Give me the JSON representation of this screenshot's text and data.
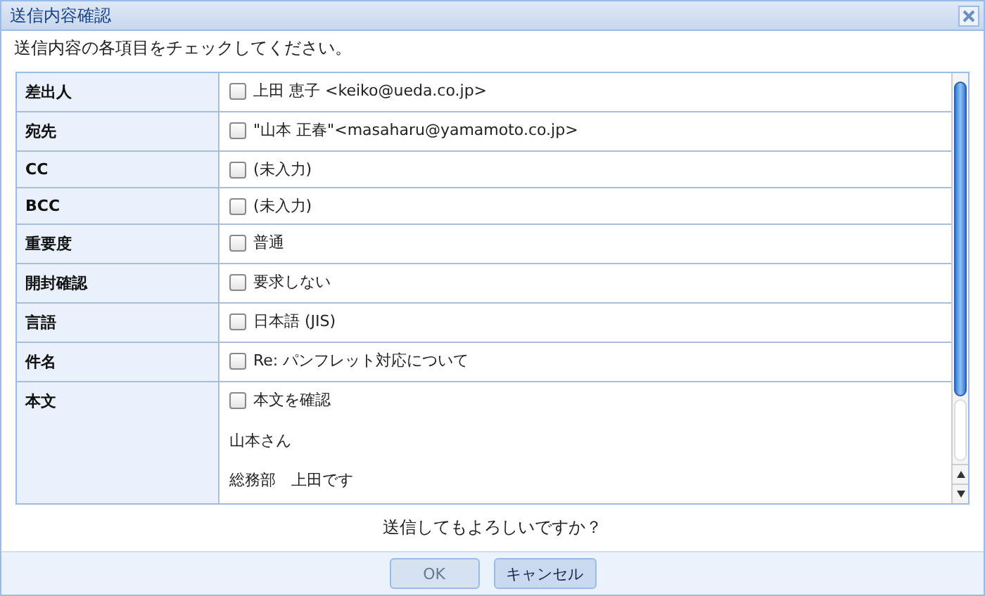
{
  "window": {
    "title": "送信内容確認"
  },
  "instruction": "送信内容の各項目をチェックしてください。",
  "fields": [
    {
      "label": "差出人",
      "value": "上田 恵子 <keiko@ueda.co.jp>",
      "checked": false
    },
    {
      "label": "宛先",
      "value": "\"山本 正春\"<masaharu@yamamoto.co.jp>",
      "checked": false
    },
    {
      "label": "CC",
      "value": "(未入力)",
      "checked": false
    },
    {
      "label": "BCC",
      "value": "(未入力)",
      "checked": false
    },
    {
      "label": "重要度",
      "value": "普通",
      "checked": false
    },
    {
      "label": "開封確認",
      "value": "要求しない",
      "checked": false
    },
    {
      "label": "言語",
      "value": "日本語 (JIS)",
      "checked": false
    },
    {
      "label": "件名",
      "value": "Re: パンフレット対応について",
      "checked": false
    },
    {
      "label": "本文",
      "value": "本文を確認",
      "checked": false,
      "body_lines": [
        "山本さん",
        "総務部　上田です"
      ]
    }
  ],
  "question": "送信してもよろしいですか？",
  "buttons": [
    {
      "label": "OK",
      "disabled": true
    },
    {
      "label": "キャンセル",
      "disabled": false
    }
  ]
}
